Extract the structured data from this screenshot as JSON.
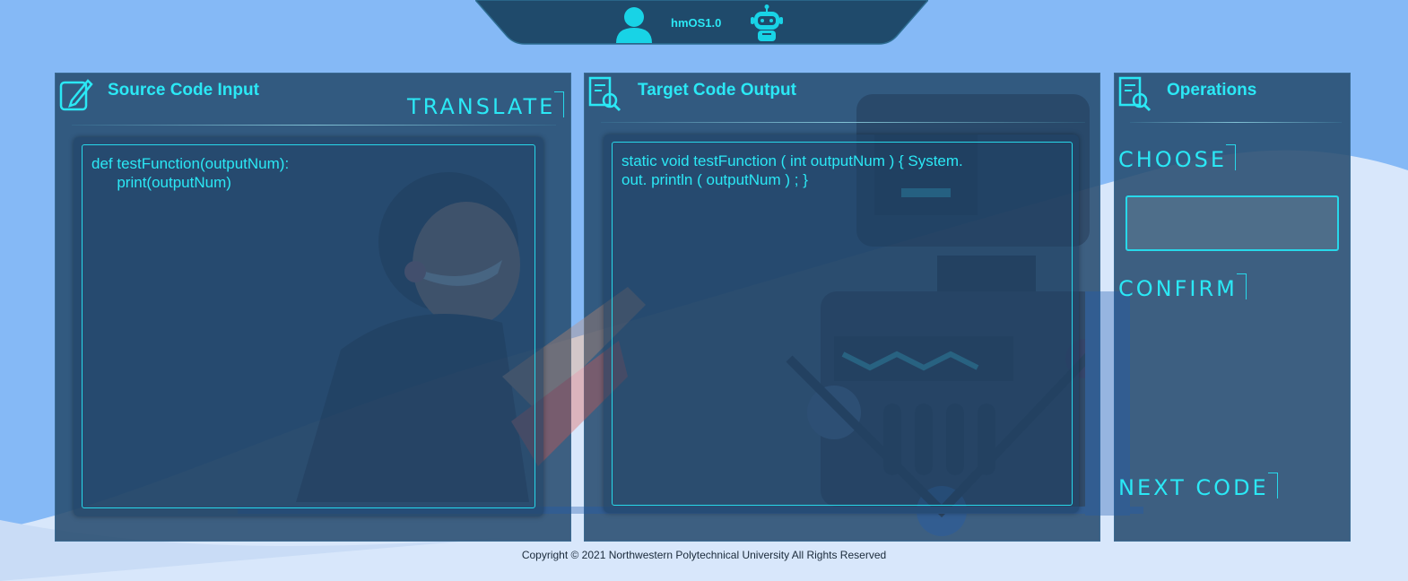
{
  "header": {
    "brand": "hmOS1.0",
    "user_icon": "user-icon",
    "robot_icon": "robot-icon"
  },
  "source_panel": {
    "title": "Source Code Input",
    "icon": "edit-icon",
    "translate_label": "TRANSLATE",
    "code": "def testFunction(outputNum):\n      print(outputNum)"
  },
  "target_panel": {
    "title": "Target Code Output",
    "icon": "document-search-icon",
    "code": "static void testFunction ( int outputNum ) { System.\nout. println ( outputNum ) ; }"
  },
  "operations_panel": {
    "title": "Operations",
    "icon": "document-search-icon",
    "choose_label": "CHOOSE",
    "choose_value": "",
    "confirm_label": "CONFIRM",
    "next_label": "NEXT CODE"
  },
  "footer": {
    "copyright": "Copyright © 2021 Northwestern Polytechnical University All Rights Reserved"
  },
  "colors": {
    "accent": "#2be8f5",
    "panel": "#274c70",
    "sky": "#85b9f6",
    "header": "#1f4a6b"
  }
}
